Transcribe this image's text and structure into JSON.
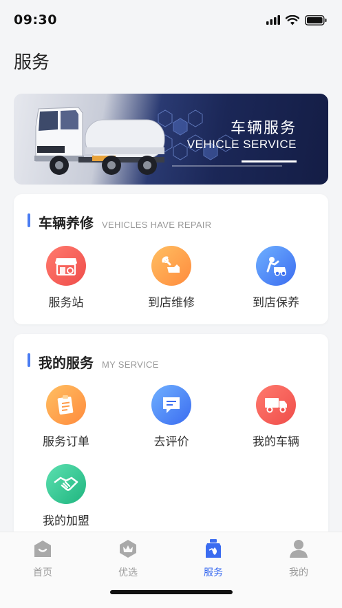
{
  "status_bar": {
    "time": "09:30"
  },
  "header": {
    "title": "服务"
  },
  "banner": {
    "title_cn": "车辆服务",
    "title_en": "VEHICLE SERVICE"
  },
  "sections": [
    {
      "title": "车辆养修",
      "subtitle": "VEHICLES HAVE REPAIR",
      "items": [
        {
          "label": "服务站",
          "icon": "service-station-icon"
        },
        {
          "label": "到店维修",
          "icon": "repair-icon"
        },
        {
          "label": "到店保养",
          "icon": "maintenance-icon"
        }
      ]
    },
    {
      "title": "我的服务",
      "subtitle": "MY SERVICE",
      "items": [
        {
          "label": "服务订单",
          "icon": "order-icon"
        },
        {
          "label": "去评价",
          "icon": "comment-icon"
        },
        {
          "label": "我的车辆",
          "icon": "truck-icon"
        },
        {
          "label": "我的加盟",
          "icon": "handshake-icon"
        }
      ]
    }
  ],
  "tab_bar": {
    "tabs": [
      {
        "label": "首页",
        "icon": "home-icon",
        "active": false
      },
      {
        "label": "优选",
        "icon": "crown-icon",
        "active": false
      },
      {
        "label": "服务",
        "icon": "service-icon",
        "active": true
      },
      {
        "label": "我的",
        "icon": "profile-icon",
        "active": false
      }
    ]
  },
  "colors": {
    "accent": "#3b6cf0",
    "red": "#ef4d4a",
    "orange": "#ff8b3d",
    "green": "#1fb57f",
    "inactive": "#9a9a9a"
  }
}
